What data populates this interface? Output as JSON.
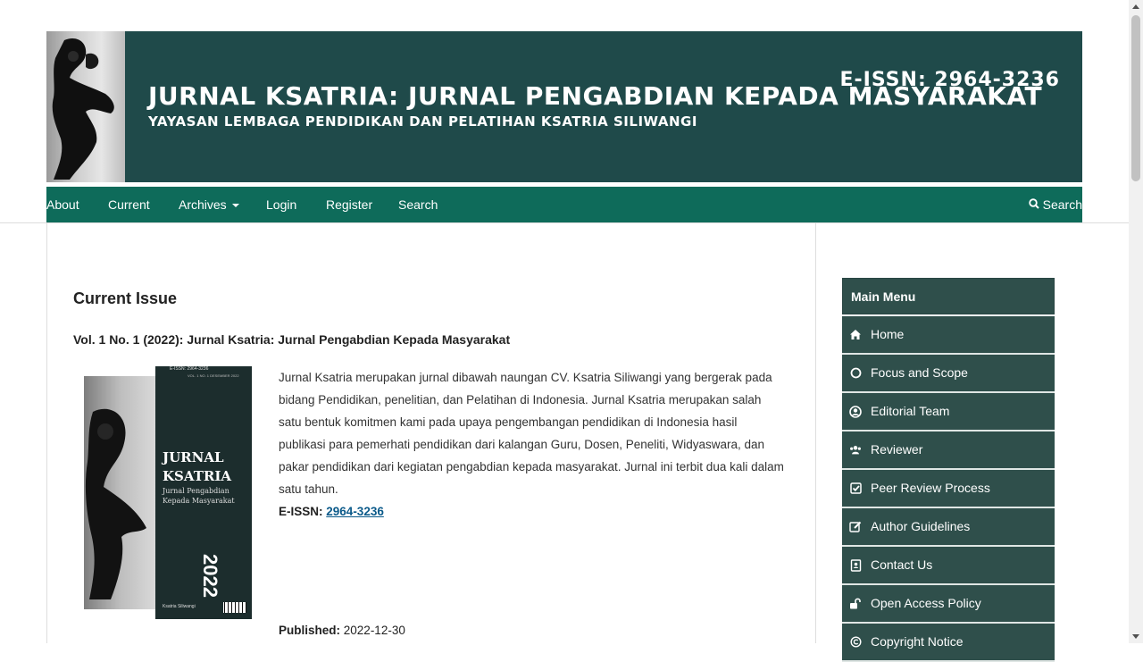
{
  "banner": {
    "issn": "E-ISSN: 2964-3236",
    "title": "JURNAL KSATRIA: JURNAL PENGABDIAN KEPADA MASYARAKAT",
    "subtitle": "YAYASAN LEMBAGA PENDIDIKAN DAN PELATIHAN KSATRIA SILIWANGI"
  },
  "nav": {
    "items": [
      "About",
      "Current",
      "Archives",
      "Login",
      "Register",
      "Search"
    ],
    "search_label": "Search",
    "search_icon": "search-icon"
  },
  "main": {
    "page_title": "Current Issue",
    "issue_title": "Vol. 1 No. 1 (2022): Jurnal Ksatria: Jurnal Pengabdian Kepada Masyarakat",
    "cover": {
      "issn": "E-ISSN: 2964-3236",
      "vol": "VOL. 1 NO. 1 DESEMBER 2022",
      "title_line1": "JURNAL",
      "title_line2": "KSATRIA",
      "sub_line1": "Jurnal Pengabdian",
      "sub_line2": "Kepada Masyarakat",
      "year": "2022",
      "publisher": "Ksatria Siliwangi"
    },
    "description": "Jurnal Ksatria merupakan jurnal dibawah naungan CV. Ksatria Siliwangi yang bergerak pada bidang Pendidikan, penelitian, dan Pelatihan di Indonesia. Jurnal Ksatria merupakan salah satu bentuk komitmen kami pada upaya pengembangan pendidikan di Indonesia hasil publikasi para pemerhati pendidikan dari kalangan Guru, Dosen, Peneliti, Widyaswara, dan pakar pendidikan dari kegiatan pengabdian kepada masyarakat. Jurnal ini terbit dua kali dalam satu tahun.",
    "issn_label": "E-ISSN:",
    "issn_value": "2964-3236",
    "published_label": "Published:",
    "published_value": "2022-12-30"
  },
  "sidebar": {
    "heading": "Main Menu",
    "items": [
      {
        "label": "Home",
        "icon": "home-icon"
      },
      {
        "label": "Focus and Scope",
        "icon": "circle-icon"
      },
      {
        "label": "Editorial Team",
        "icon": "user-circle-icon"
      },
      {
        "label": "Reviewer",
        "icon": "users-icon"
      },
      {
        "label": "Peer Review Process",
        "icon": "check-square-icon"
      },
      {
        "label": "Author Guidelines",
        "icon": "edit-icon"
      },
      {
        "label": "Contact Us",
        "icon": "contact-book-icon"
      },
      {
        "label": "Open Access Policy",
        "icon": "unlock-icon"
      },
      {
        "label": "Copyright Notice",
        "icon": "copyright-icon"
      }
    ]
  },
  "colors": {
    "banner_bg": "#1f4a4a",
    "nav_bg": "#0e6b5a",
    "sidebar_bg": "#2f4f4b",
    "link": "#0b5a8a"
  }
}
